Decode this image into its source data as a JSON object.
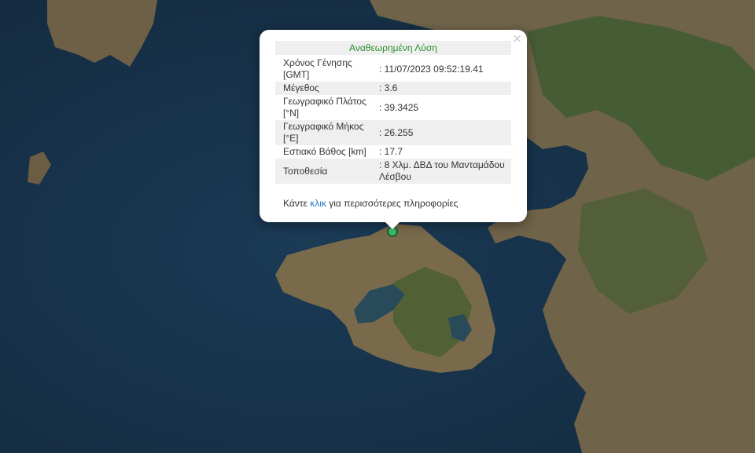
{
  "popup": {
    "title": "Αναθεωρημένη Λύση",
    "close_glyph": "×",
    "rows": [
      {
        "label": "Χρόνος Γένησης [GMT]",
        "value": ": 11/07/2023 09:52:19.41"
      },
      {
        "label": "Μέγεθος",
        "value": ": 3.6"
      },
      {
        "label": "Γεωγραφικό Πλάτος [°N]",
        "value": ": 39.3425"
      },
      {
        "label": "Γεωγραφικό Μήκος [°E]",
        "value": ": 26.255"
      },
      {
        "label": "Εστιακό Βάθος [km]",
        "value": ": 17.7"
      },
      {
        "label": "Τοποθεσία",
        "value": ": 8 Χλμ. ΔΒΔ του Μανταμάδου Λέσβου"
      }
    ],
    "more_prefix": "Κάντε ",
    "more_link": "κλικ",
    "more_suffix": " για περισσότερες πληροφορίες"
  },
  "marker": {
    "icon": "earthquake-marker-icon",
    "color": "#3dba6a"
  },
  "colors": {
    "sea": "#17324a",
    "land": "#6e6148",
    "forest": "#3f5a30",
    "lake": "#2a4d5c"
  }
}
